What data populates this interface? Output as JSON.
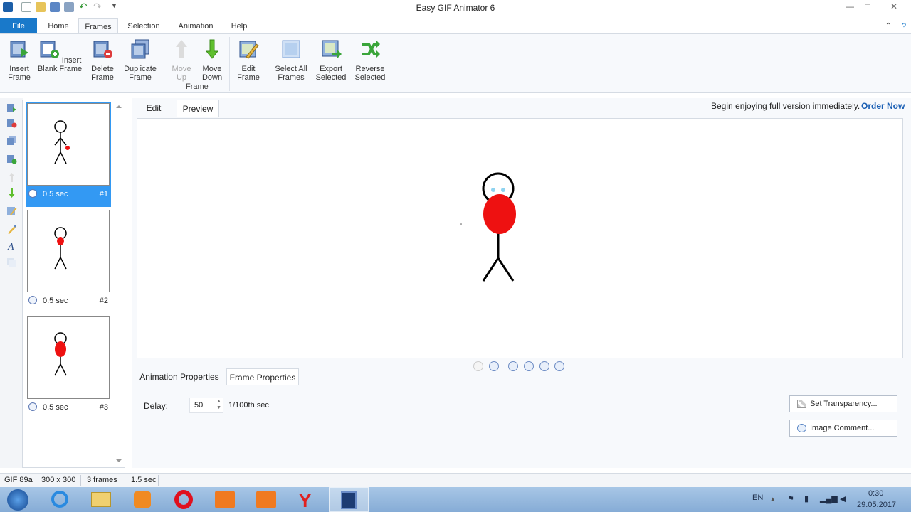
{
  "window": {
    "title": "Easy GIF Animator 6"
  },
  "title_controls": {
    "minimize": "—",
    "maximize": "□",
    "close": "✕"
  },
  "ribbon_tabs": [
    {
      "label": "File"
    },
    {
      "label": "Home"
    },
    {
      "label": "Frames"
    },
    {
      "label": "Selection"
    },
    {
      "label": "Animation"
    },
    {
      "label": "Help"
    }
  ],
  "ribbon": {
    "insert_frame": "Insert Frame",
    "insert_blank_frame": "Insert Blank Frame",
    "delete_frame": "Delete Frame",
    "duplicate_frame": "Duplicate Frame",
    "move_up": "Move Up",
    "move_down": "Move Down",
    "group_frame": "Frame",
    "edit_frame": "Edit Frame",
    "select_all_frames": "Select All Frames",
    "export_selected": "Export Selected",
    "reverse_selected": "Reverse Selected"
  },
  "frames": [
    {
      "delay": "0.5 sec",
      "number": "#1"
    },
    {
      "delay": "0.5 sec",
      "number": "#2"
    },
    {
      "delay": "0.5 sec",
      "number": "#3"
    }
  ],
  "preview_tabs": {
    "edit": "Edit",
    "preview": "Preview"
  },
  "promo": {
    "text": "Begin enjoying full version immediately.",
    "link": "Order Now"
  },
  "property_tabs": {
    "animation": "Animation Properties",
    "frame": "Frame Properties"
  },
  "frame_properties": {
    "delay_label": "Delay:",
    "delay_value": "50",
    "delay_unit": "1/100th sec",
    "set_transparency": "Set Transparency...",
    "image_comment": "Image Comment..."
  },
  "status": {
    "format": "GIF 89a",
    "size": "300 x 300",
    "frames": "3 frames",
    "duration": "1.5 sec"
  },
  "tray": {
    "lang": "EN",
    "time": "0:30",
    "date": "29.05.2017"
  },
  "colors": {
    "accent": "#1979ca",
    "selection": "#3399f3",
    "figure_red": "#ee1111",
    "link": "#1a5fb4"
  }
}
